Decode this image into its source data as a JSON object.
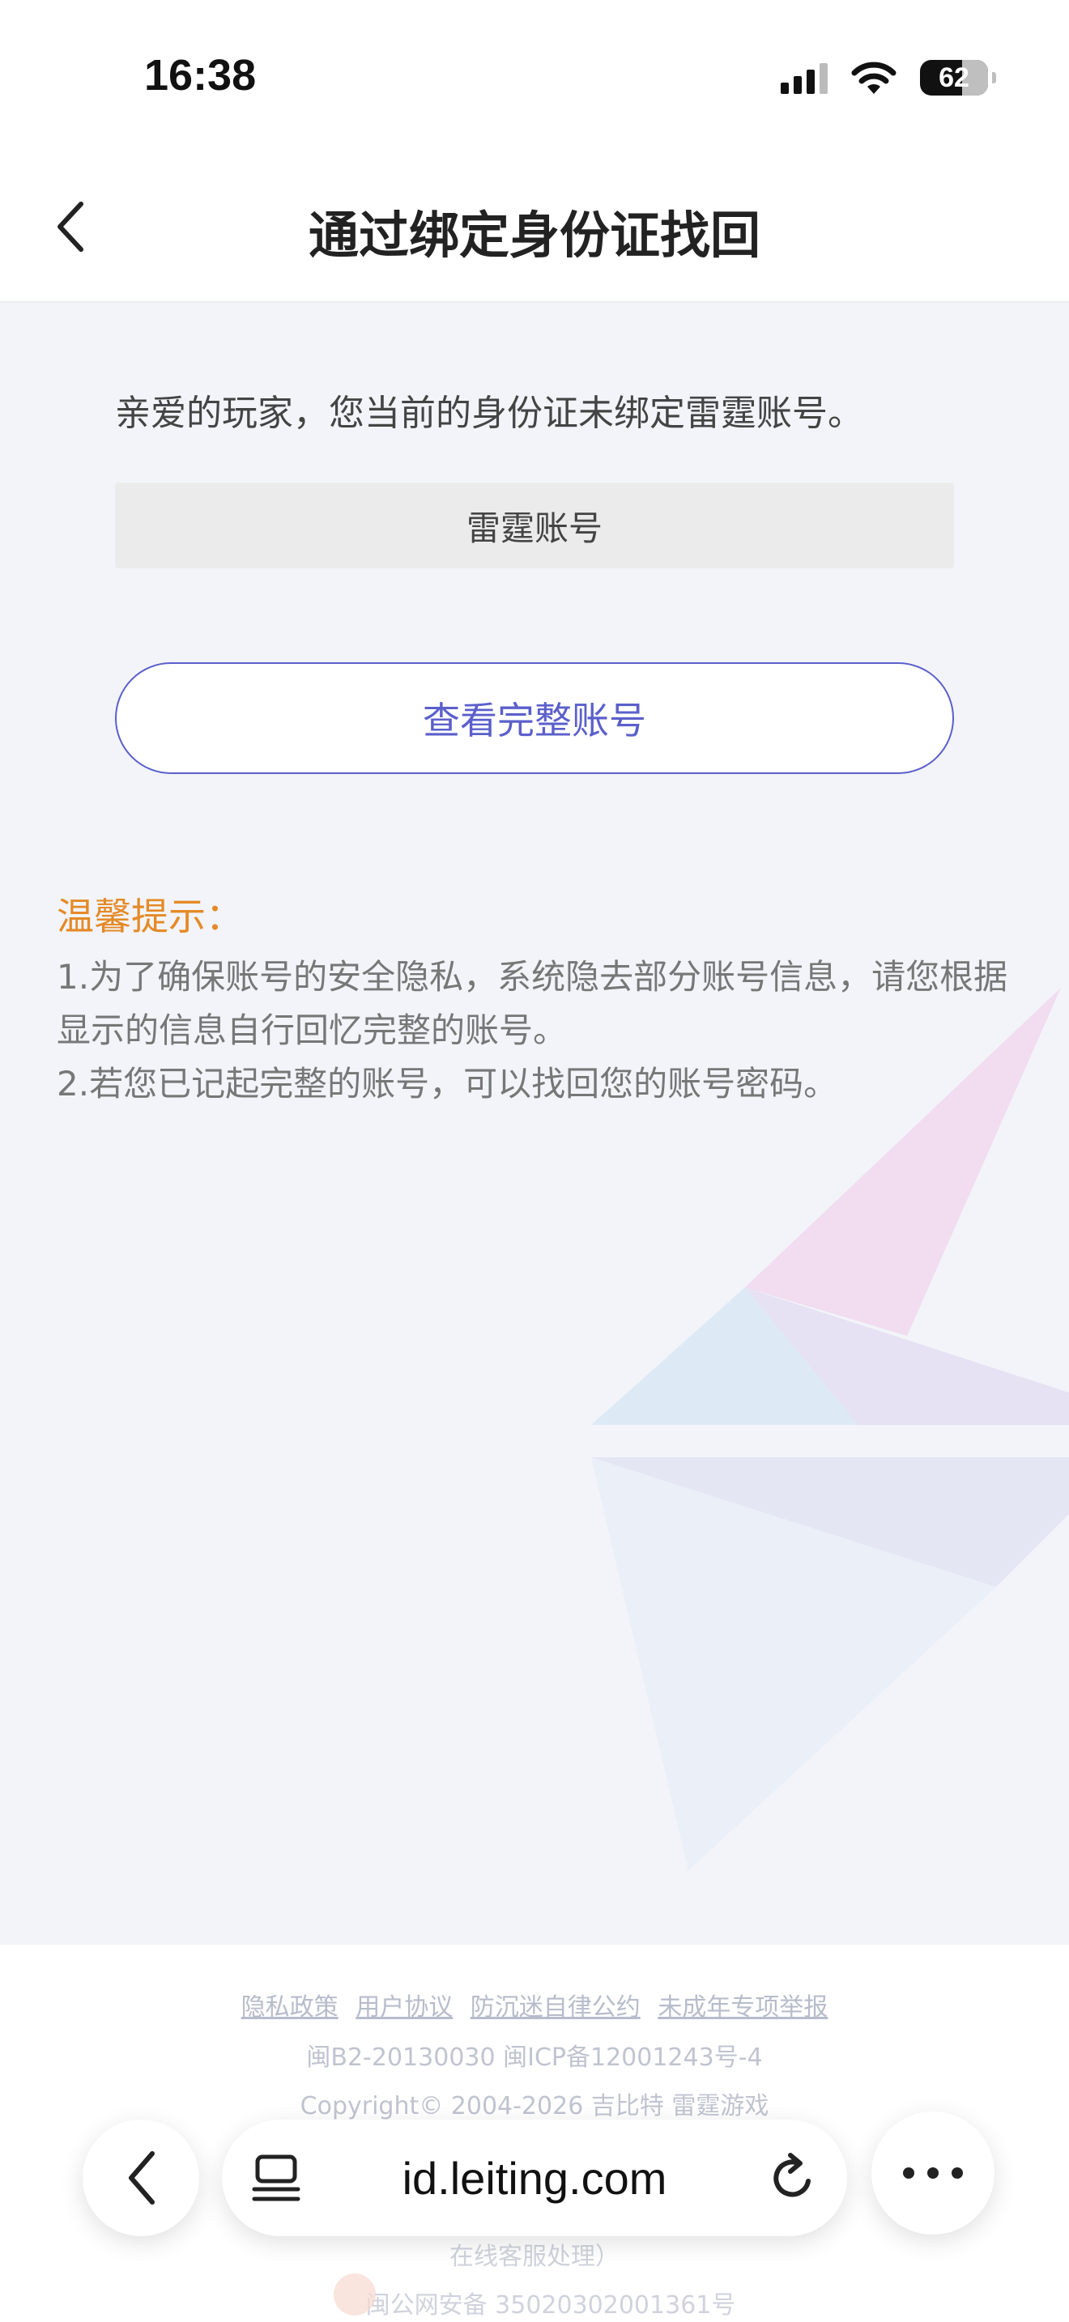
{
  "status_bar": {
    "time": "16:38",
    "battery": "62"
  },
  "header": {
    "title": "通过绑定身份证找回"
  },
  "main": {
    "message": "亲爱的玩家，您当前的身份证未绑定雷霆账号。",
    "account_placeholder": "雷霆账号",
    "view_full_button": "查看完整账号",
    "tips_title": "温馨提示：",
    "tips": [
      "1.为了确保账号的安全隐私，系统隐去部分账号信息，请您根据显示的信息自行回忆完整的账号。",
      "2.若您已记起完整的账号，可以找回您的账号密码。"
    ]
  },
  "footer": {
    "links": [
      "隐私政策",
      "用户协议",
      "防沉迷自律公约",
      "未成年专项举报"
    ],
    "icp": "闽B2-20130030  闽ICP备12001243号-4",
    "copyright": "Copyright© 2004-2026  吉比特  雷霆游戏",
    "online_service": "在线客服处理）",
    "police": "闽公网安备  35020302001361号"
  },
  "browser": {
    "url": "id.leiting.com"
  },
  "colors": {
    "accent": "#5b5fcb",
    "tip_orange": "#e58a27",
    "page_bg": "#f2f4f9"
  },
  "icons": [
    "back-chevron-icon",
    "signal-icon",
    "wifi-icon",
    "battery-icon",
    "reader-mode-icon",
    "reload-icon",
    "more-icon"
  ]
}
